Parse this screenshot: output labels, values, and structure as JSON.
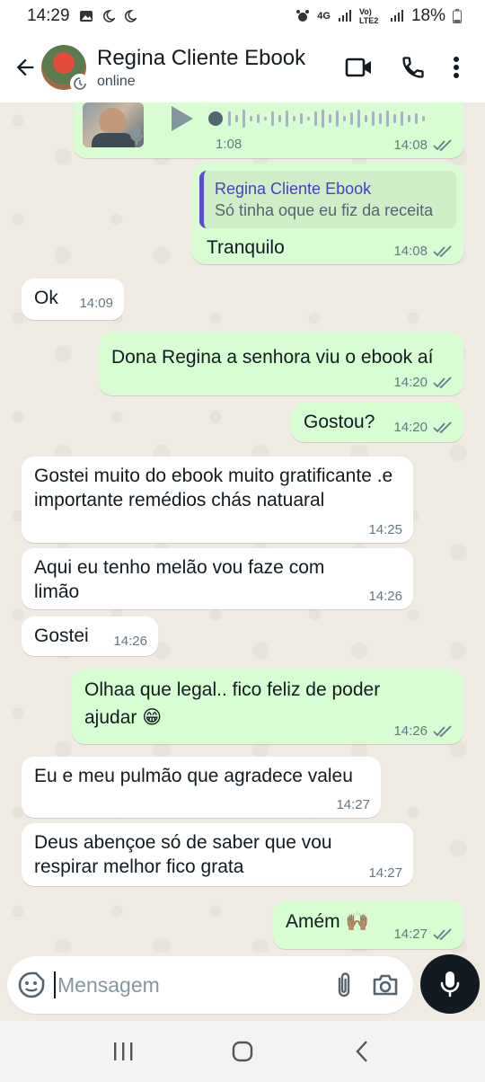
{
  "status_bar": {
    "time": "14:29",
    "network_label": "4G",
    "volte_label": "Vo) LTE2",
    "battery": "18%"
  },
  "header": {
    "contact_name": "Regina Cliente Ebook",
    "contact_status": "online",
    "icons": [
      "back-arrow-icon",
      "video-call-icon",
      "phone-icon",
      "more-vert-icon"
    ]
  },
  "messages": [
    {
      "type": "voice",
      "direction": "out",
      "duration": "1:08",
      "time": "14:08",
      "read": true
    },
    {
      "type": "reply",
      "direction": "out",
      "quote_name": "Regina Cliente Ebook",
      "quote_text": "Só tinha oque eu fiz da receita",
      "text": "Tranquilo",
      "time": "14:08",
      "read": true
    },
    {
      "type": "text",
      "direction": "in",
      "text": "Ok",
      "time": "14:09"
    },
    {
      "type": "text",
      "direction": "out",
      "text": "Dona Regina a senhora viu o ebook aí",
      "time": "14:20",
      "read": true
    },
    {
      "type": "text",
      "direction": "out",
      "text": "Gostou?",
      "time": "14:20",
      "read": true
    },
    {
      "type": "text",
      "direction": "in",
      "text": "Gostei muito do ebook muito gratificante .e importante remédios chás natuaral",
      "time": "14:25"
    },
    {
      "type": "text",
      "direction": "in",
      "text": "Aqui eu tenho melão vou faze com limão",
      "time": "14:26"
    },
    {
      "type": "text",
      "direction": "in",
      "text": "Gostei",
      "time": "14:26"
    },
    {
      "type": "text",
      "direction": "out",
      "text": "Olhaa que legal.. fico feliz de poder ajudar 😁",
      "time": "14:26",
      "read": true
    },
    {
      "type": "text",
      "direction": "in",
      "text": "Eu e meu pulmão que agradece valeu",
      "time": "14:27"
    },
    {
      "type": "text",
      "direction": "in",
      "text": "Deus abençoe só de saber que vou respirar melhor fico grata",
      "time": "14:27"
    },
    {
      "type": "text",
      "direction": "out",
      "text": "Amém 🙌🏽",
      "time": "14:27",
      "read": true
    }
  ],
  "input": {
    "placeholder": "Mensagem",
    "icons": [
      "emoji-sticker-icon",
      "attach-icon",
      "camera-icon",
      "mic-icon"
    ]
  },
  "colors": {
    "outgoing_bubble": "#d9fdd3",
    "incoming_bubble": "#ffffff",
    "chat_background": "#efeae2",
    "read_ticks": "#667781",
    "quote_accent": "#5b4ccf"
  }
}
